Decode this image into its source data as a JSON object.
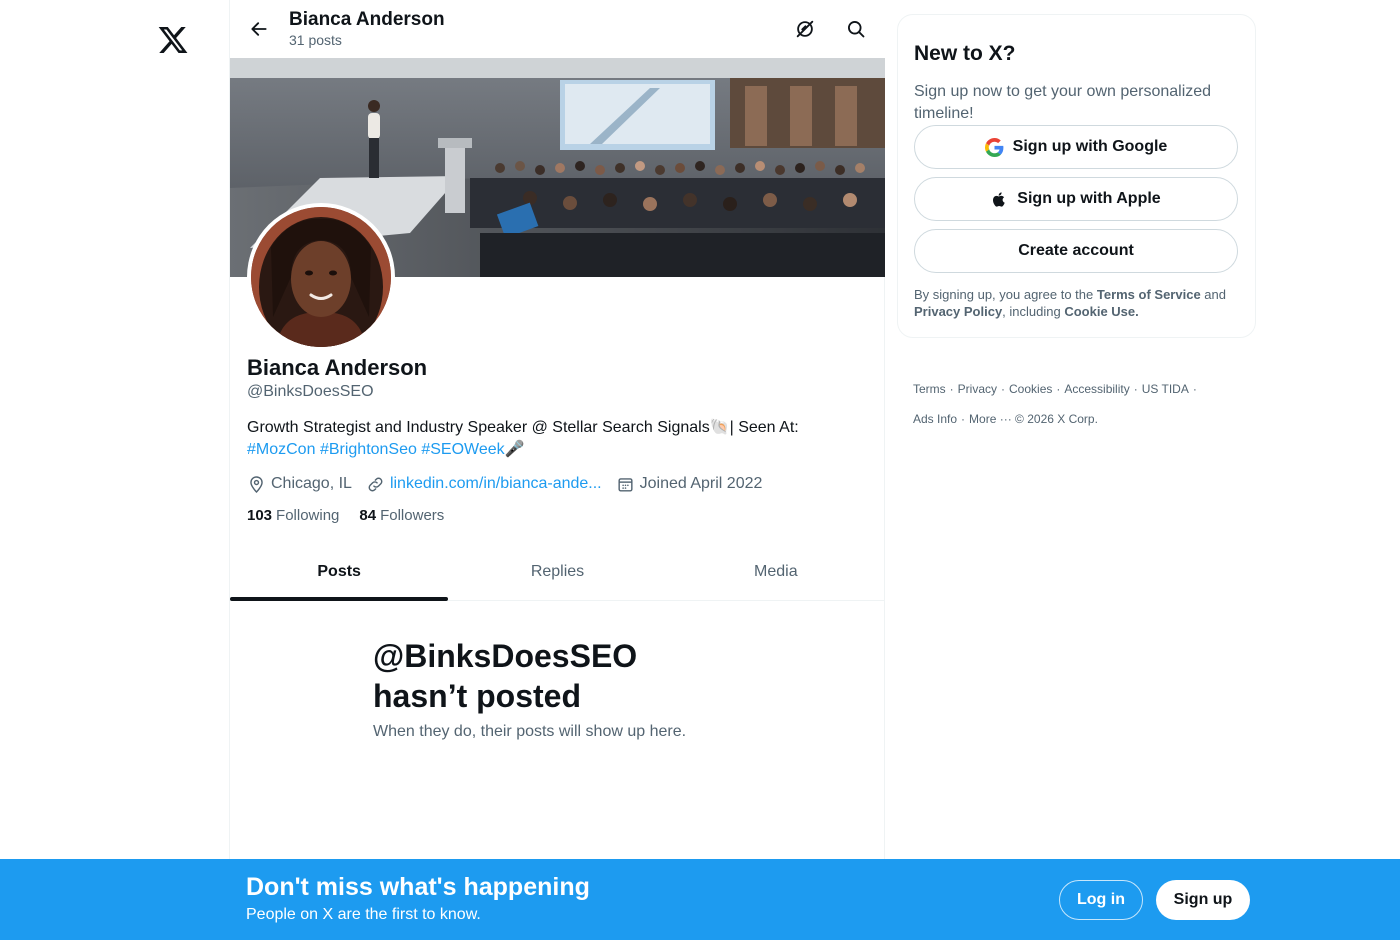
{
  "header": {
    "name": "Bianca Anderson",
    "posts_count": "31 posts"
  },
  "profile": {
    "name": "Bianca Anderson",
    "handle": "@BinksDoesSEO",
    "bio_text": "Growth Strategist and Industry Speaker @ Stellar Search Signals🐚| Seen At:",
    "bio_tags": [
      "#MozCon",
      "#BrightonSeo",
      "#SEOWeek"
    ],
    "bio_tail": "🎤",
    "location": "Chicago, IL",
    "website": "linkedin.com/in/bianca-ande...",
    "joined": "Joined April 2022",
    "following_count": "103",
    "following_label": "Following",
    "followers_count": "84",
    "followers_label": "Followers"
  },
  "tabs": [
    {
      "label": "Posts",
      "active": true
    },
    {
      "label": "Replies",
      "active": false
    },
    {
      "label": "Media",
      "active": false
    }
  ],
  "empty_state": {
    "title_line1": "@BinksDoesSEO",
    "title_line2": "hasn’t posted",
    "subtitle": "When they do, their posts will show up here."
  },
  "signup_card": {
    "title": "New to X?",
    "subtitle": "Sign up now to get your own personalized timeline!",
    "google_label": "Sign up with Google",
    "apple_label": "Sign up with Apple",
    "create_label": "Create account",
    "legal_prefix": "By signing up, you agree to the ",
    "terms_link": "Terms of Service",
    "legal_and": " and ",
    "privacy_link": "Privacy Policy",
    "legal_including": ", including ",
    "cookie_link": "Cookie Use."
  },
  "footer": {
    "links": [
      "Terms",
      "Privacy",
      "Cookies",
      "Accessibility",
      "US TIDA",
      "Ads Info",
      "More ···"
    ],
    "copyright": "© 2026 X Corp."
  },
  "bottom_bar": {
    "title": "Don't miss what's happening",
    "subtitle": "People on X are the first to know.",
    "login_label": "Log in",
    "signup_label": "Sign up"
  },
  "colors": {
    "accent": "#1d9bf0",
    "text_primary": "#0f1419",
    "text_secondary": "#536471",
    "border": "#eff3f4"
  }
}
